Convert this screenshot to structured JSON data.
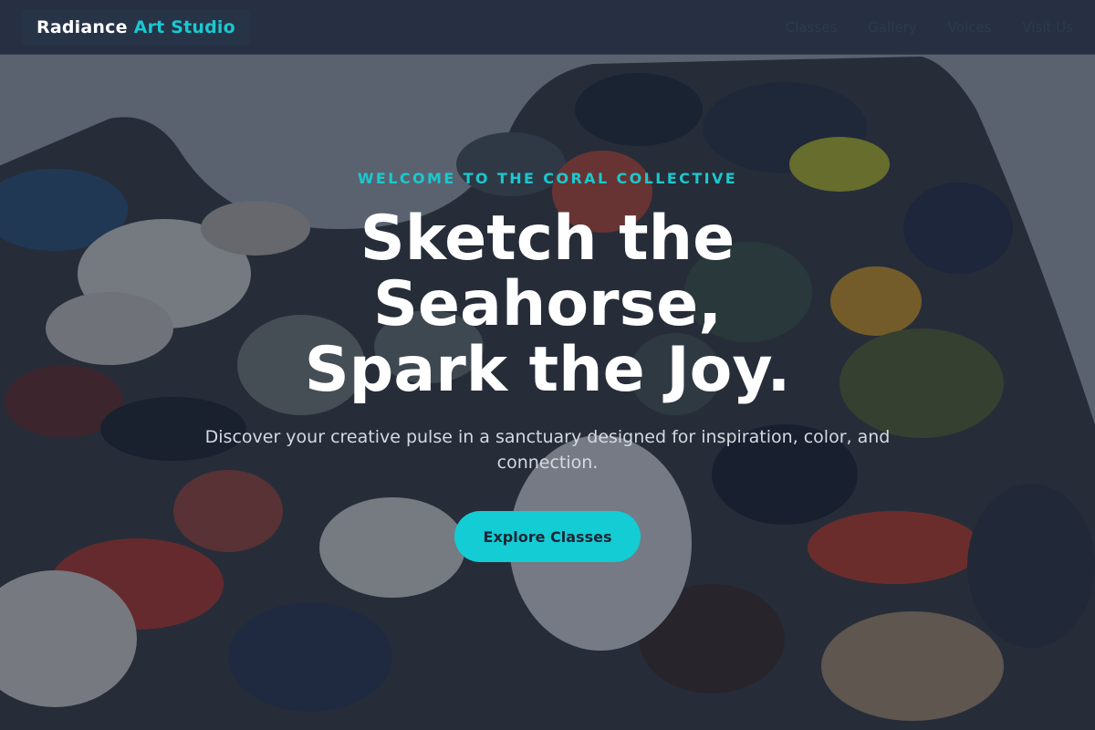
{
  "brand": {
    "name": "Radiance",
    "accent": "Art Studio"
  },
  "nav": {
    "links": [
      {
        "label": "Classes"
      },
      {
        "label": "Gallery"
      },
      {
        "label": "Voices"
      },
      {
        "label": "Visit Us"
      }
    ]
  },
  "hero": {
    "eyebrow": "WELCOME TO THE CORAL COLLECTIVE",
    "headline_lines": [
      "Sketch the",
      "Seahorse,",
      "Spark the Joy."
    ],
    "subtext": "Discover your creative pulse in a sanctuary designed for inspiration, color, and connection.",
    "cta_label": "Explore Classes"
  },
  "colors": {
    "accent": "#19c9cf",
    "cta_background": "#14ccd4",
    "navbar_background": "#222c3e",
    "headline": "#ffffff"
  }
}
